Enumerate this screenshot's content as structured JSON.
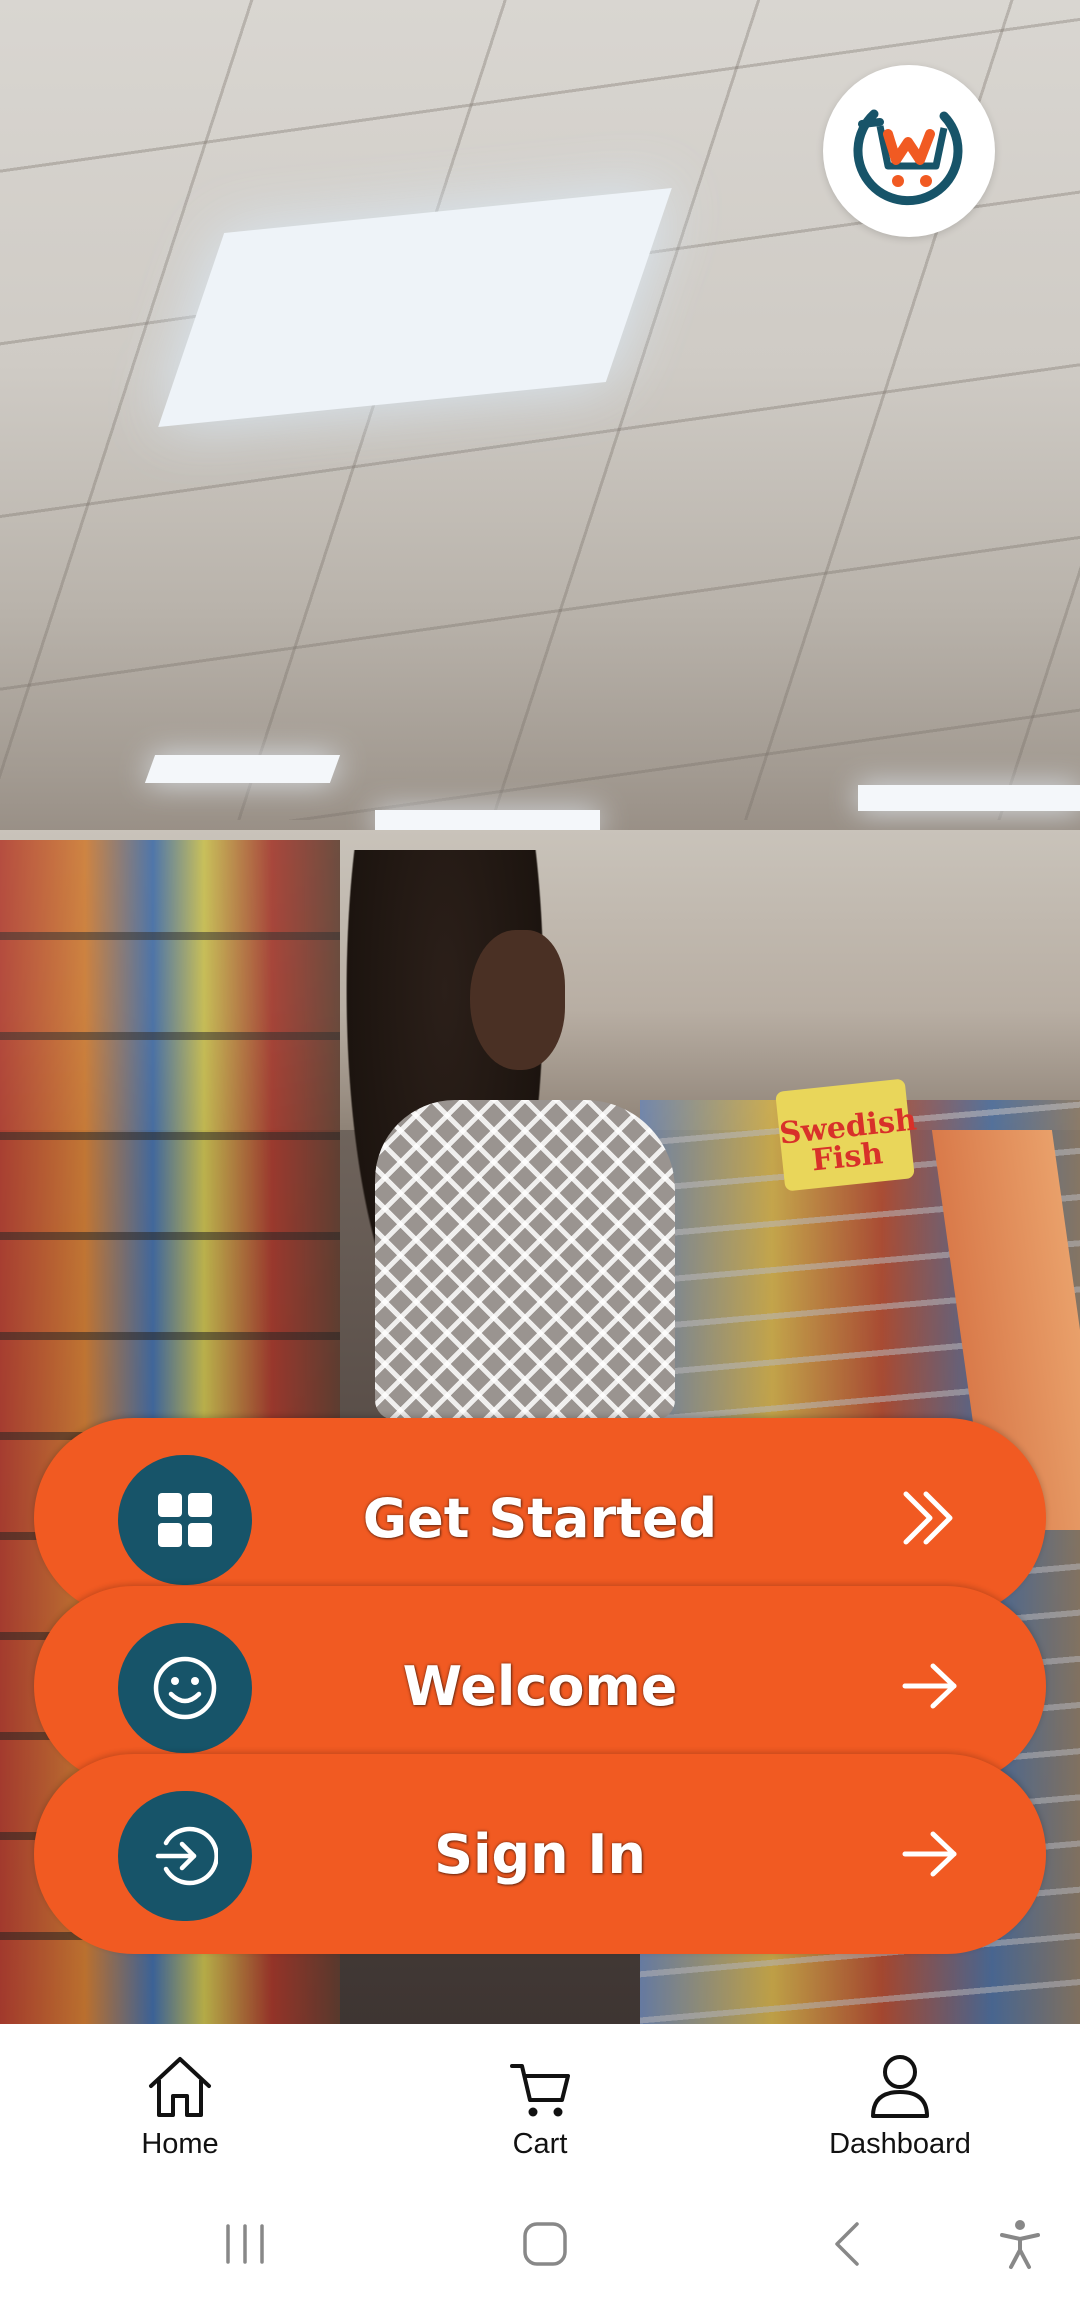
{
  "app": {
    "logo_icon": "shopping-cart-logo-icon",
    "brand_colors": {
      "primary": "#f15a22",
      "secondary": "#175469"
    }
  },
  "actions": [
    {
      "label": "Get Started",
      "icon": "grid-icon",
      "arrow": "double-chevron-right-icon"
    },
    {
      "label": "Welcome",
      "icon": "smiley-icon",
      "arrow": "arrow-right-icon"
    },
    {
      "label": "Sign In",
      "icon": "sign-in-icon",
      "arrow": "arrow-right-icon"
    }
  ],
  "promo": {
    "candy_text": "Swedish Fish"
  },
  "bottom_nav": [
    {
      "label": "Home",
      "icon": "home-icon"
    },
    {
      "label": "Cart",
      "icon": "cart-icon"
    },
    {
      "label": "Dashboard",
      "icon": "user-icon"
    }
  ],
  "system_nav": [
    "recent-apps-icon",
    "home-circle-icon",
    "back-icon",
    "accessibility-icon"
  ]
}
